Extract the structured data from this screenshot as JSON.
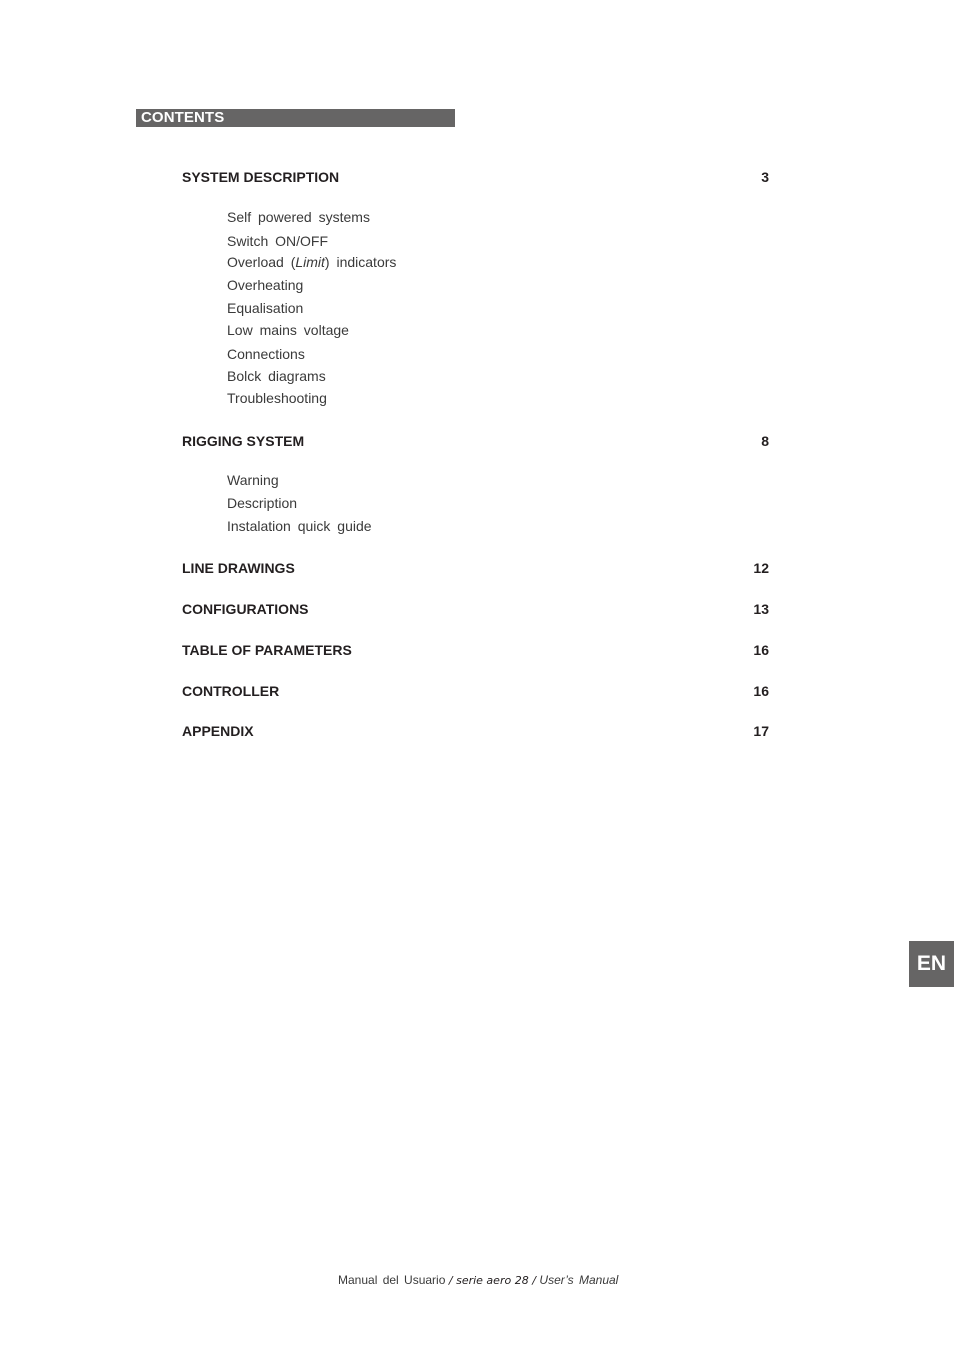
{
  "header": {
    "title": "CONTENTS"
  },
  "toc": {
    "sections": [
      {
        "title": "SYSTEM DESCRIPTION",
        "page": "3",
        "subitems": [
          "Self powered systems",
          "Switch ON/OFF",
          "Overload (Limit) indicators",
          "Overheating",
          "Equalisation",
          "Low mains voltage",
          "Connections",
          "Bolck diagrams",
          "Troubleshooting"
        ]
      },
      {
        "title": "RIGGING SYSTEM",
        "page": "8",
        "subitems": [
          "Warning",
          "Description",
          "Instalation quick guide"
        ]
      },
      {
        "title": "LINE DRAWINGS",
        "page": "12",
        "subitems": []
      },
      {
        "title": "CONFIGURATIONS",
        "page": "13",
        "subitems": []
      },
      {
        "title": "TABLE OF PARAMETERS",
        "page": "16",
        "subitems": []
      },
      {
        "title": "CONTROLLER",
        "page": "16",
        "subitems": []
      },
      {
        "title": "APPENDIX",
        "page": "17",
        "subitems": []
      }
    ],
    "overload_parts": {
      "before": "Overload (",
      "italic": "Limit",
      "after": ") indicators"
    }
  },
  "language_tab": {
    "label": "EN"
  },
  "footer": {
    "left": "Manual del Usuario",
    "separator1": " / ",
    "middle": "serie aero 28",
    "separator2": " / ",
    "right": "User’s Manual"
  }
}
